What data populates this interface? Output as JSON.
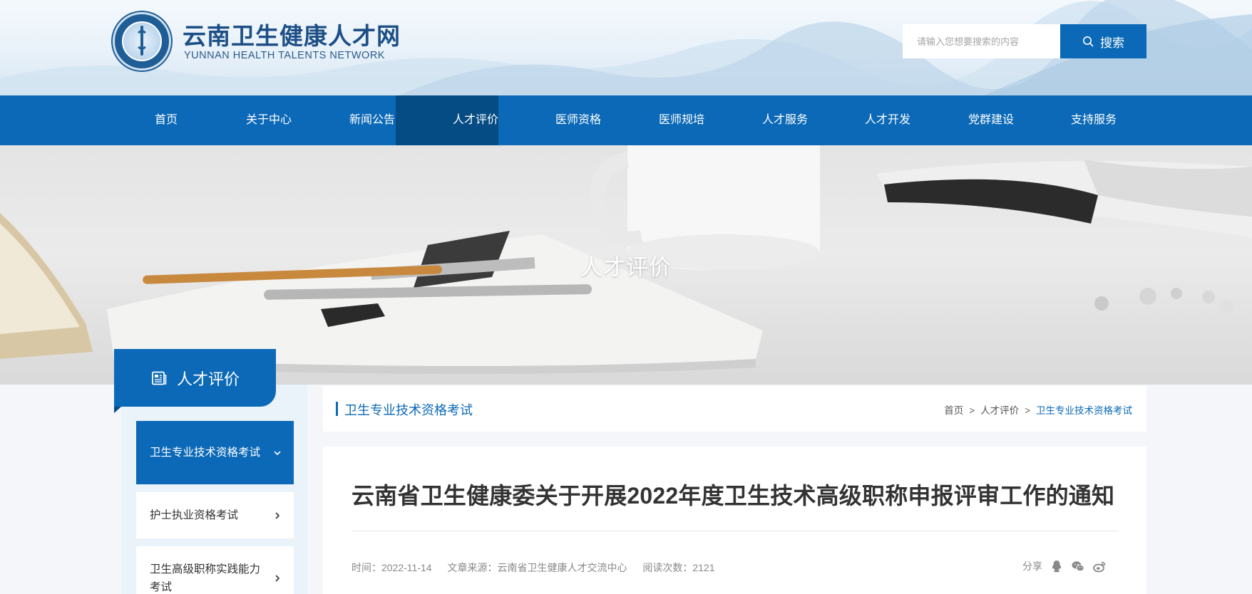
{
  "site": {
    "title": "云南卫生健康人才网",
    "subtitle": "YUNNAN HEALTH TALENTS NETWORK",
    "logo_icon": "medical-emblem-logo"
  },
  "search": {
    "placeholder": "请输入您想要搜索的内容",
    "button_label": "搜索",
    "icon": "search-icon"
  },
  "nav": {
    "items": [
      {
        "label": "首页"
      },
      {
        "label": "关于中心"
      },
      {
        "label": "新闻公告"
      },
      {
        "label": "人才评价"
      },
      {
        "label": "医师资格"
      },
      {
        "label": "医师规培"
      },
      {
        "label": "人才服务"
      },
      {
        "label": "人才开发"
      },
      {
        "label": "党群建设"
      },
      {
        "label": "支持服务"
      }
    ],
    "active": "人才评价"
  },
  "banner": {
    "title": "人才评价"
  },
  "sidebar": {
    "heading": "人才评价",
    "heading_icon": "newspaper-icon",
    "items": [
      {
        "label": "卫生专业技术资格考试",
        "chevron": "chevron-down-icon"
      },
      {
        "label": "护士执业资格考试",
        "chevron": "chevron-right-icon"
      },
      {
        "label": "卫生高级职称实践能力考试",
        "chevron": "chevron-right-icon"
      }
    ]
  },
  "main": {
    "category_title": "卫生专业技术资格考试",
    "breadcrumb": {
      "home": "首页",
      "section": "人才评价",
      "current": "卫生专业技术资格考试",
      "separator": ">"
    }
  },
  "article": {
    "title": "云南省卫生健康委关于开展2022年度卫生技术高级职称申报评审工作的通知",
    "time": "时间：2022-11-14",
    "source": "文章来源：云南省卫生健康人才交流中心",
    "views": "阅读次数：2121",
    "share_label": "分享",
    "share_icons": [
      "qq-icon",
      "wechat-icon",
      "weibo-icon"
    ]
  },
  "colors": {
    "primary": "#0b69b7",
    "nav_active": "#054b84",
    "side_panel_bg": "#eaf2fa",
    "page_bg": "#f4f6f9"
  }
}
